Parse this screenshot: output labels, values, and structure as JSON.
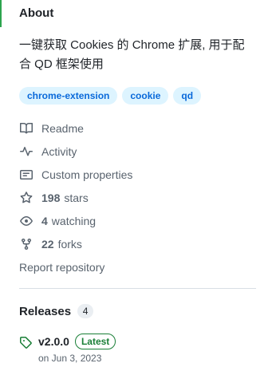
{
  "about": {
    "title": "About",
    "description": "一键获取 Cookies 的 Chrome 扩展, 用于配合 QD 框架使用",
    "topics": [
      "chrome-extension",
      "cookie",
      "qd"
    ]
  },
  "meta": {
    "readme": "Readme",
    "activity": "Activity",
    "custom_properties": "Custom properties",
    "stars_count": "198",
    "stars_label": "stars",
    "watching_count": "4",
    "watching_label": "watching",
    "forks_count": "22",
    "forks_label": "forks",
    "report": "Report repository"
  },
  "releases": {
    "title": "Releases",
    "count": "4",
    "latest": {
      "tag": "v2.0.0",
      "badge": "Latest",
      "date": "on Jun 3, 2023"
    }
  },
  "colors": {
    "accent": "#2da44e",
    "topic_bg": "#ddf4ff",
    "topic_fg": "#0969da",
    "muted": "#59636e"
  }
}
